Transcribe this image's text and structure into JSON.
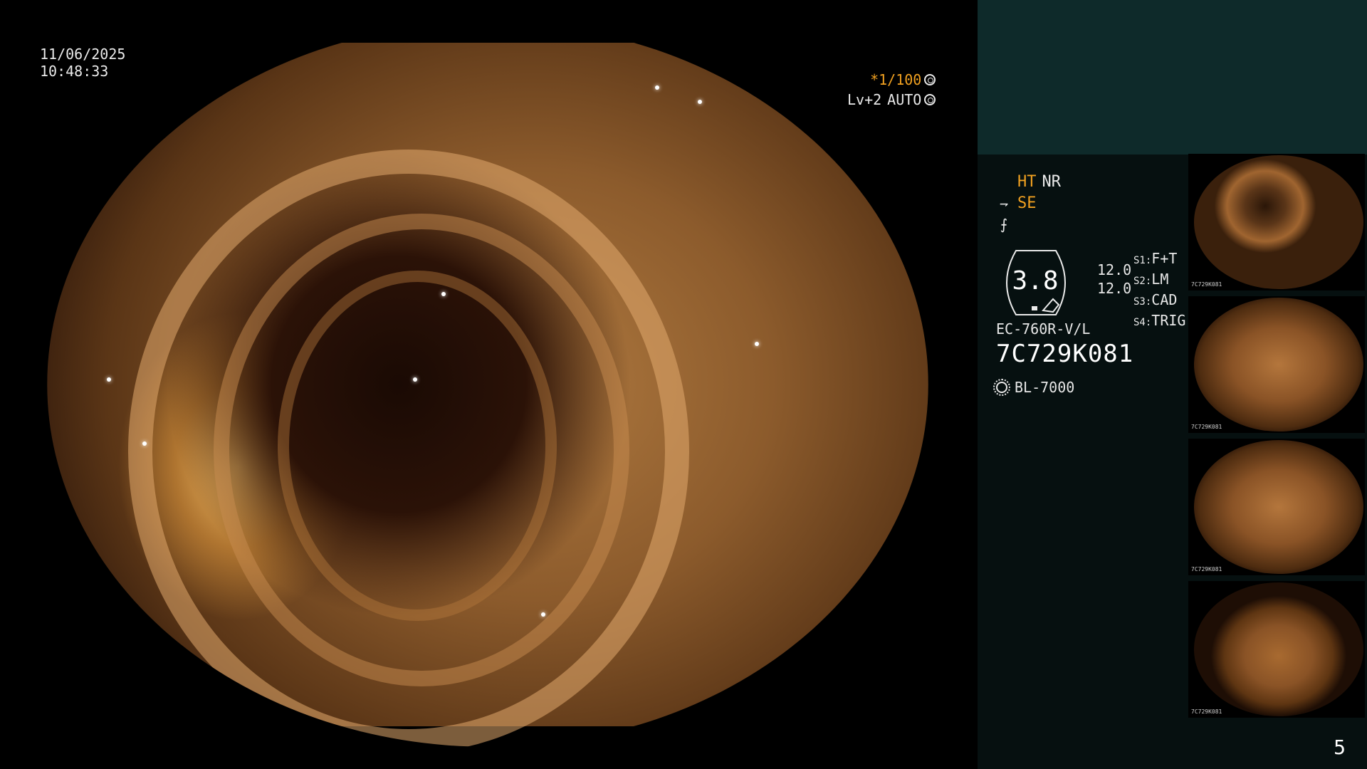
{
  "overlay": {
    "date": "11/06/2025",
    "time": "10:48:33",
    "shutter": "*1/100",
    "level": "Lv+2",
    "mode": "AUTO"
  },
  "panel": {
    "ht": "HT",
    "nr": "NR",
    "se": "SE",
    "gauge_value": "3.8",
    "gauge_num_top": "12.0",
    "gauge_num_bottom": "12.0",
    "switches": [
      {
        "key": "S1",
        "value": "F+T"
      },
      {
        "key": "S2",
        "value": "LM"
      },
      {
        "key": "S3",
        "value": "CAD"
      },
      {
        "key": "S4",
        "value": "TRIG"
      }
    ],
    "scope_model": "EC-760R-V/L",
    "serial": "7C729K081",
    "light_source": "BL-7000",
    "thumb_label": "7C729K081",
    "page_number": "5"
  },
  "colors": {
    "accent": "#f0a020",
    "panel_top": "#0e2a2a",
    "panel_bg": "#061010"
  }
}
